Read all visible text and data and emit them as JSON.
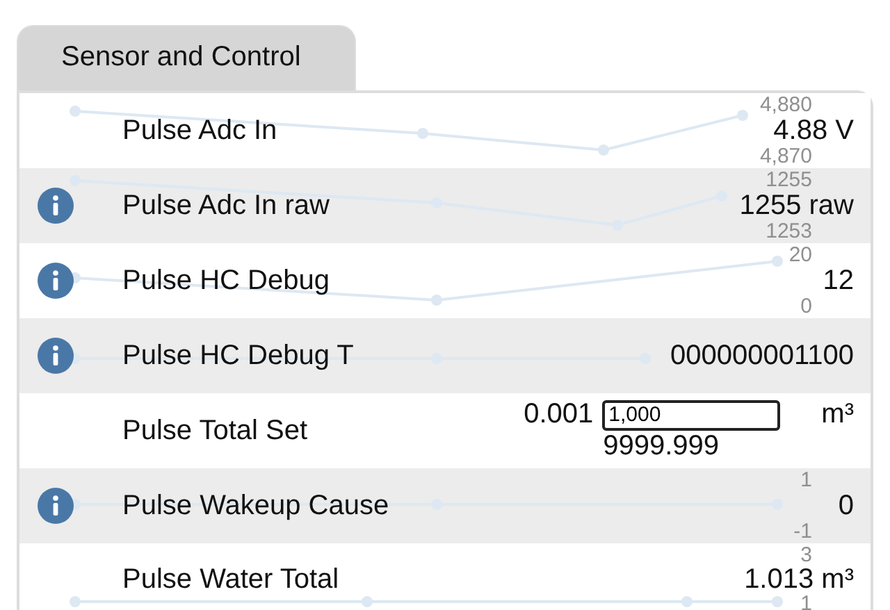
{
  "tab": {
    "label": "Sensor and Control",
    "selected": true
  },
  "rows": [
    {
      "kind": "reading",
      "info": false,
      "label": "Pulse Adc In",
      "value": "4.88 V",
      "scale_max": "4,880",
      "scale_min": "4,870"
    },
    {
      "kind": "reading",
      "info": true,
      "label": "Pulse Adc In raw",
      "value": "1255 raw",
      "scale_max": "1255",
      "scale_min": "1253"
    },
    {
      "kind": "reading",
      "info": true,
      "label": "Pulse HC Debug",
      "value": "12",
      "scale_max": "20",
      "scale_min": "0"
    },
    {
      "kind": "reading",
      "info": true,
      "label": "Pulse HC Debug T",
      "value": "000000001100"
    },
    {
      "kind": "number_input",
      "info": false,
      "label": "Pulse Total Set",
      "min": "0.001",
      "input_value": "1,000",
      "unit": "m³",
      "max": "9999.999"
    },
    {
      "kind": "reading",
      "info": true,
      "label": "Pulse Wakeup Cause",
      "value": "0",
      "scale_max": "1",
      "scale_min": "-1"
    },
    {
      "kind": "reading",
      "info": false,
      "label": "Pulse Water Total",
      "value": "1.013 m³",
      "scale_max": "3",
      "scale_min": "1"
    }
  ]
}
